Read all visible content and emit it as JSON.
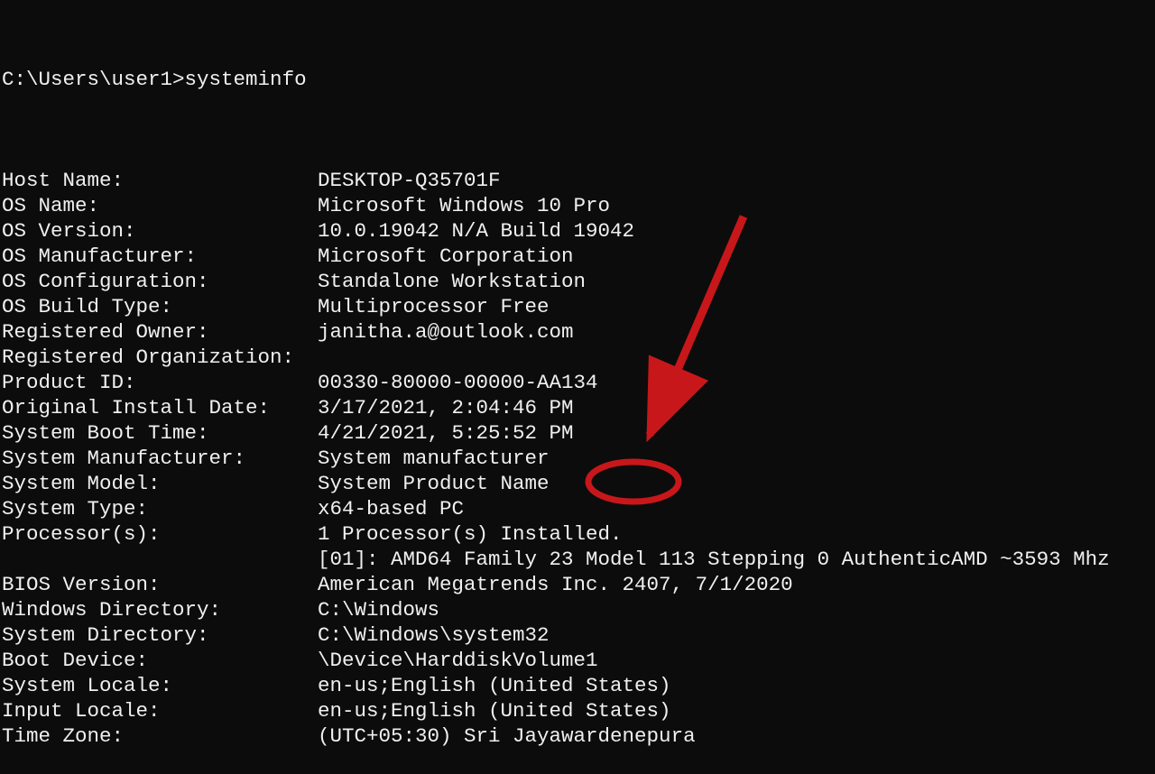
{
  "prompt": {
    "path": "C:\\Users\\user1>",
    "command": "systeminfo"
  },
  "rows": [
    {
      "label": "Host Name:",
      "value": "DESKTOP-Q35701F"
    },
    {
      "label": "OS Name:",
      "value": "Microsoft Windows 10 Pro"
    },
    {
      "label": "OS Version:",
      "value": "10.0.19042 N/A Build 19042"
    },
    {
      "label": "OS Manufacturer:",
      "value": "Microsoft Corporation"
    },
    {
      "label": "OS Configuration:",
      "value": "Standalone Workstation"
    },
    {
      "label": "OS Build Type:",
      "value": "Multiprocessor Free"
    },
    {
      "label": "Registered Owner:",
      "value": "janitha.a@outlook.com"
    },
    {
      "label": "Registered Organization:",
      "value": ""
    },
    {
      "label": "Product ID:",
      "value": "00330-80000-00000-AA134"
    },
    {
      "label": "Original Install Date:",
      "value": "3/17/2021, 2:04:46 PM"
    },
    {
      "label": "System Boot Time:",
      "value": "4/21/2021, 5:25:52 PM"
    },
    {
      "label": "System Manufacturer:",
      "value": "System manufacturer"
    },
    {
      "label": "System Model:",
      "value": "System Product Name"
    },
    {
      "label": "System Type:",
      "value": "x64-based PC"
    },
    {
      "label": "Processor(s):",
      "value": "1 Processor(s) Installed."
    },
    {
      "label": "",
      "value": "[01]: AMD64 Family 23 Model 113 Stepping 0 AuthenticAMD ~3593 Mhz"
    },
    {
      "label": "BIOS Version:",
      "value": "American Megatrends Inc. 2407, 7/1/2020"
    },
    {
      "label": "Windows Directory:",
      "value": "C:\\Windows"
    },
    {
      "label": "System Directory:",
      "value": "C:\\Windows\\system32"
    },
    {
      "label": "Boot Device:",
      "value": "\\Device\\HarddiskVolume1"
    },
    {
      "label": "System Locale:",
      "value": "en-us;English (United States)"
    },
    {
      "label": "Input Locale:",
      "value": "en-us;English (United States)"
    },
    {
      "label": "Time Zone:",
      "value": "(UTC+05:30) Sri Jayawardenepura"
    }
  ],
  "annotation": {
    "arrow_color": "#c8171a",
    "circle_color": "#c8171a"
  }
}
